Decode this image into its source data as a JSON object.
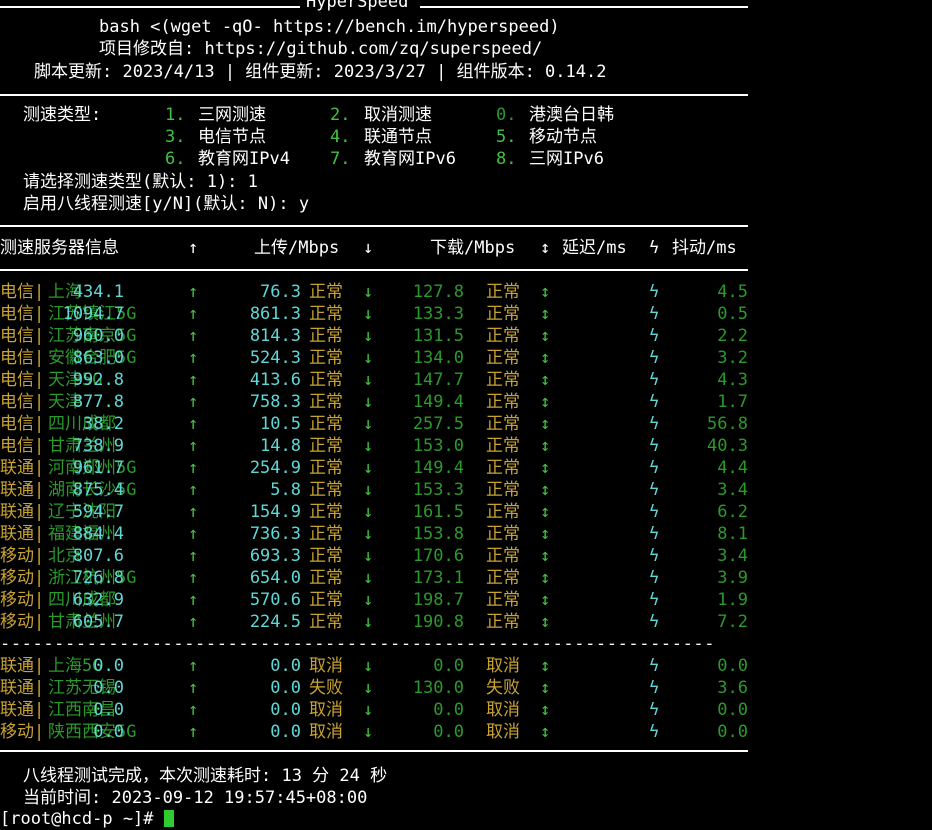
{
  "header": {
    "title": "HyperSpeed",
    "cmd": "bash <(wget -qO- https://bench.im/hyperspeed)",
    "repo": "项目修改自: https://github.com/zq/superspeed/",
    "versions": "脚本更新: 2023/4/13 | 组件更新: 2023/3/27 | 组件版本: 0.14.2"
  },
  "menu": {
    "label": "测速类型:",
    "options": [
      {
        "num": "1.",
        "text": "三网测速"
      },
      {
        "num": "2.",
        "text": "取消测速"
      },
      {
        "num": "0.",
        "text": "港澳台日韩"
      },
      {
        "num": "3.",
        "text": "电信节点"
      },
      {
        "num": "4.",
        "text": "联通节点"
      },
      {
        "num": "5.",
        "text": "移动节点"
      },
      {
        "num": "6.",
        "text": "教育网IPv4"
      },
      {
        "num": "7.",
        "text": "教育网IPv6"
      },
      {
        "num": "8.",
        "text": "三网IPv6"
      }
    ],
    "prompt1": "请选择测速类型(默认: 1): 1",
    "prompt2": "启用八线程测速[y/N](默认: N): y"
  },
  "table": {
    "headers": {
      "server": "测速服务器信息",
      "up_arrow": "↑",
      "upload": "上传/Mbps",
      "down_arrow": "↓",
      "download": "下载/Mbps",
      "updown_arrow": "↕",
      "latency": "延迟/ms",
      "bolt": "ϟ",
      "jitter": "抖动/ms"
    },
    "rows": [
      {
        "isp": "电信",
        "loc": "上海",
        "up": "434.1",
        "us": "正常",
        "dn": "76.3",
        "ds": "正常",
        "lat": "127.8",
        "jit": "4.5"
      },
      {
        "isp": "电信",
        "loc": "江苏镇江5G",
        "up": "1094.7",
        "us": "正常",
        "dn": "861.3",
        "ds": "正常",
        "lat": "133.3",
        "jit": "0.5"
      },
      {
        "isp": "电信",
        "loc": "江苏南京5G",
        "up": "960.0",
        "us": "正常",
        "dn": "814.3",
        "ds": "正常",
        "lat": "131.5",
        "jit": "2.2"
      },
      {
        "isp": "电信",
        "loc": "安徽合肥5G",
        "up": "863.0",
        "us": "正常",
        "dn": "524.3",
        "ds": "正常",
        "lat": "134.0",
        "jit": "3.2"
      },
      {
        "isp": "电信",
        "loc": "天津5G",
        "up": "992.8",
        "us": "正常",
        "dn": "413.6",
        "ds": "正常",
        "lat": "147.7",
        "jit": "4.3"
      },
      {
        "isp": "电信",
        "loc": "天津",
        "up": "877.8",
        "us": "正常",
        "dn": "758.3",
        "ds": "正常",
        "lat": "149.4",
        "jit": "1.7"
      },
      {
        "isp": "电信",
        "loc": "四川成都",
        "up": "38.2",
        "us": "正常",
        "dn": "10.5",
        "ds": "正常",
        "lat": "257.5",
        "jit": "56.8"
      },
      {
        "isp": "电信",
        "loc": "甘肃兰州",
        "up": "738.9",
        "us": "正常",
        "dn": "14.8",
        "ds": "正常",
        "lat": "153.0",
        "jit": "40.3"
      },
      {
        "isp": "联通",
        "loc": "河南郑州5G",
        "up": "961.7",
        "us": "正常",
        "dn": "254.9",
        "ds": "正常",
        "lat": "149.4",
        "jit": "4.4"
      },
      {
        "isp": "联通",
        "loc": "湖南长沙5G",
        "up": "875.4",
        "us": "正常",
        "dn": "5.8",
        "ds": "正常",
        "lat": "153.3",
        "jit": "3.4"
      },
      {
        "isp": "联通",
        "loc": "辽宁沈阳",
        "up": "594.7",
        "us": "正常",
        "dn": "154.9",
        "ds": "正常",
        "lat": "161.5",
        "jit": "6.2"
      },
      {
        "isp": "联通",
        "loc": "福建福州",
        "up": "884.4",
        "us": "正常",
        "dn": "736.3",
        "ds": "正常",
        "lat": "153.8",
        "jit": "8.1"
      },
      {
        "isp": "移动",
        "loc": "北京",
        "up": "807.6",
        "us": "正常",
        "dn": "693.3",
        "ds": "正常",
        "lat": "170.6",
        "jit": "3.4"
      },
      {
        "isp": "移动",
        "loc": "浙江杭州5G",
        "up": "726.8",
        "us": "正常",
        "dn": "654.0",
        "ds": "正常",
        "lat": "173.1",
        "jit": "3.9"
      },
      {
        "isp": "移动",
        "loc": "四川成都",
        "up": "632.9",
        "us": "正常",
        "dn": "570.6",
        "ds": "正常",
        "lat": "198.7",
        "jit": "1.9"
      },
      {
        "isp": "移动",
        "loc": "甘肃兰州",
        "up": "605.7",
        "us": "正常",
        "dn": "224.5",
        "ds": "正常",
        "lat": "190.8",
        "jit": "7.2"
      }
    ],
    "failed_rows": [
      {
        "isp": "联通",
        "loc": "上海5G",
        "up": "0.0",
        "us": "取消",
        "dn": "0.0",
        "ds": "取消",
        "lat": "0.0",
        "jit": "0.0"
      },
      {
        "isp": "联通",
        "loc": "江苏无锡",
        "up": "0.0",
        "us": "失败",
        "dn": "0.0",
        "ds": "失败",
        "lat": "130.0",
        "jit": "3.6"
      },
      {
        "isp": "联通",
        "loc": "江西南昌",
        "up": "0.0",
        "us": "取消",
        "dn": "0.0",
        "ds": "取消",
        "lat": "0.0",
        "jit": "0.0"
      },
      {
        "isp": "移动",
        "loc": "陕西西安5G",
        "up": "0.0",
        "us": "取消",
        "dn": "0.0",
        "ds": "取消",
        "lat": "0.0",
        "jit": "0.0"
      }
    ]
  },
  "footer": {
    "done": "八线程测试完成，本次测速耗时: 13 分 24 秒",
    "time": "当前时间: 2023-09-12 19:57:45+08:00",
    "prompt": "[root@hcd-p ~]# "
  },
  "colors": {
    "cyan": "#5fd7d7",
    "orange": "#c9a332",
    "green": "#44c044",
    "cursor": "#2ecc2e"
  }
}
